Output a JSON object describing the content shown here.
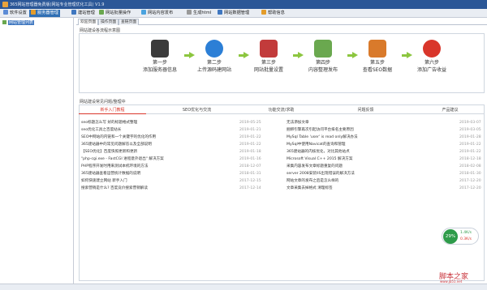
{
  "window": {
    "title": "365网站管理器免费版(网站专业管理优化工具) V1.9"
  },
  "menu": [
    {
      "label": "软件设置",
      "icon": "gear-icon",
      "color": "#5b8bd6"
    },
    {
      "label": "服务器管理",
      "icon": "server-icon",
      "color": "#e39c2b"
    },
    {
      "label": "建站管理",
      "icon": "build-icon",
      "color": "#3f77c0"
    },
    {
      "label": "网站批量操作",
      "icon": "batch-icon",
      "color": "#6aa84f"
    },
    {
      "label": "网站内容发布",
      "icon": "publish-icon",
      "color": "#4aa3df"
    },
    {
      "label": "生成html",
      "icon": "html-icon",
      "color": "#999999"
    },
    {
      "label": "网站数据管理",
      "icon": "data-icon",
      "color": "#3f77c0"
    },
    {
      "label": "帮助信息",
      "icon": "help-icon",
      "color": "#e39c2b"
    }
  ],
  "sidebar": {
    "items": [
      {
        "label": "网站管理列表",
        "icon": "site-icon"
      }
    ]
  },
  "tabs": [
    {
      "label": "欢迎页面"
    },
    {
      "label": "操作页面"
    },
    {
      "label": "查链页面"
    }
  ],
  "flow": {
    "title": "网站建设各流程示意图",
    "steps": [
      {
        "n": "第一步",
        "d": "添加服务器信息",
        "icon": "server-add-icon",
        "color": "#3b3b3b"
      },
      {
        "n": "第二步",
        "d": "上传源码建网站",
        "icon": "ie-icon",
        "color": "#2c7fd6"
      },
      {
        "n": "第三步",
        "d": "网站批量设置",
        "icon": "tools-icon",
        "color": "#c23b3b"
      },
      {
        "n": "第四步",
        "d": "内容整理发布",
        "icon": "network-icon",
        "color": "#6aa84f"
      },
      {
        "n": "第五步",
        "d": "查看SEO数据",
        "icon": "chart-icon",
        "color": "#d97a2b"
      },
      {
        "n": "第六步",
        "d": "添加广告收益",
        "icon": "ad-icon",
        "color": "#d9362b"
      }
    ]
  },
  "news": {
    "title": "网站建设常见问题/整理中",
    "categories": [
      {
        "label": "新手入门教程"
      },
      {
        "label": "SEO优化与交流"
      },
      {
        "label": "功能交流/求助"
      },
      {
        "label": "问题反馈"
      },
      {
        "label": "产品建议"
      }
    ],
    "left": [
      {
        "t": "seo标题怎么写 好的标题格式整理",
        "d": "2019-05-25"
      },
      {
        "t": "seo优化工具之百度站长",
        "d": "2019-01-21"
      },
      {
        "t": "SEO中网站的内链和一个关键字的优化的作用",
        "d": "2019-01-22"
      },
      {
        "t": "365建站器中的常见问题解答以及全部说明",
        "d": "2019-01-22"
      },
      {
        "t": "【SEO优化】百度快照更新和更新",
        "d": "2019-01-18"
      },
      {
        "t": "\"php-cgi.exe - FastCGI 进程意外退出\" 解决方案",
        "d": "2019-01-16"
      },
      {
        "t": "PHP程序开发时用来测试本机环境的方法",
        "d": "2018-12-07"
      },
      {
        "t": "365建站器查看运营统计数据的说明",
        "d": "2018-01-31"
      },
      {
        "t": "如何快速建立网站 新手入门",
        "d": "2017-12-15"
      },
      {
        "t": "搜索营销是什么? 百度竞价搜索营销解读",
        "d": "2017-12-14"
      }
    ],
    "right": [
      {
        "t": "无法添加文章",
        "d": "2019-03-07"
      },
      {
        "t": "捆绑引擎再次引起访问平台排名主要原因",
        "d": "2019-03-05"
      },
      {
        "t": "MySql Table 'user' is read only解决办法",
        "d": "2019-01-28"
      },
      {
        "t": "MySql中使用Navicat的查询和管理",
        "d": "2019-01-22"
      },
      {
        "t": "365建站器的内核优化，对比其他站点",
        "d": "2019-01-22"
      },
      {
        "t": "Microsoft Visual C++ 2015 解决方案",
        "d": "2018-12-18"
      },
      {
        "t": "采集内容发布文章标题重复的问题",
        "d": "2018-02-08"
      },
      {
        "t": "server 2008安装IIS出现错误的解决方法",
        "d": "2018-01-30"
      },
      {
        "t": "网站文章的发布之后是怎么样的",
        "d": "2017-12-20"
      },
      {
        "t": "文章采集去掉格式 清理标签",
        "d": "2017-12-20"
      }
    ]
  },
  "widget": {
    "percent": "29%",
    "up": "1.4K/s",
    "down": "0.3K/s"
  },
  "watermark": {
    "brand": "脚本之家",
    "url": "www.jb51.net"
  }
}
